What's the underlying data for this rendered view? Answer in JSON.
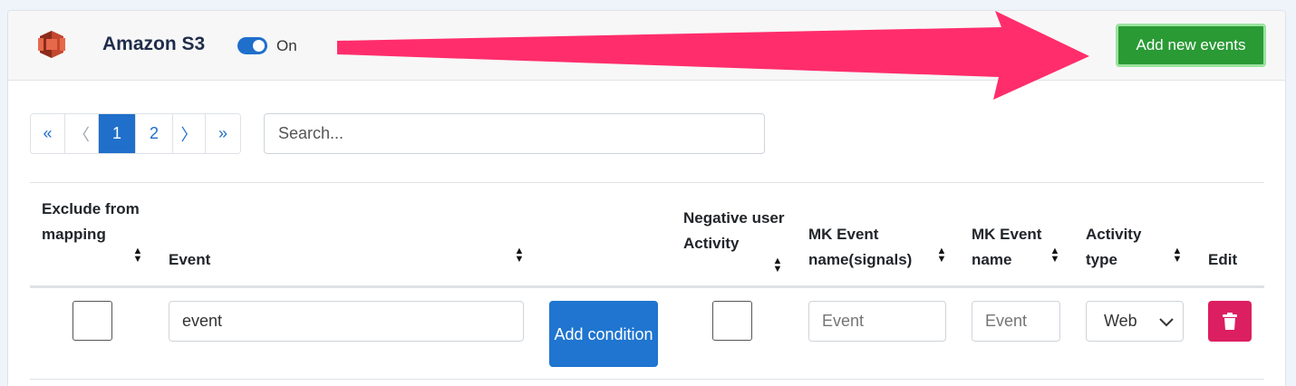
{
  "header": {
    "title": "Amazon S3",
    "toggle_label": "On",
    "toggle_on": true,
    "add_button_label": "Add new events"
  },
  "pagination": {
    "first": "«",
    "prev": "〈",
    "pages": [
      "1",
      "2"
    ],
    "active_page": "1",
    "next": "〉",
    "last": "»"
  },
  "search": {
    "placeholder": "Search..."
  },
  "table": {
    "columns": {
      "exclude": "Exclude from mapping",
      "event": "Event",
      "negative": "Negative user Activity",
      "mk_signals": "MK Event name(signals)",
      "mk_name": "MK Event name",
      "activity": "Activity type",
      "edit": "Edit"
    },
    "rows": [
      {
        "exclude_checked": false,
        "event_value": "event",
        "condition_label": "Add condition",
        "negative_checked": false,
        "mk_signals_placeholder": "Event",
        "mk_name_placeholder": "Event",
        "activity_value": "Web"
      }
    ]
  },
  "icons": {
    "logo": "aws-s3-logo",
    "sort": "sort-icon",
    "chevron": "chevron-down-icon",
    "delete": "trash-icon",
    "annotation": "arrow-annotation"
  },
  "colors": {
    "primary": "#1f6fcb",
    "success": "#2a9a35",
    "danger": "#dc1f61",
    "arrow": "#ff2d6b"
  }
}
